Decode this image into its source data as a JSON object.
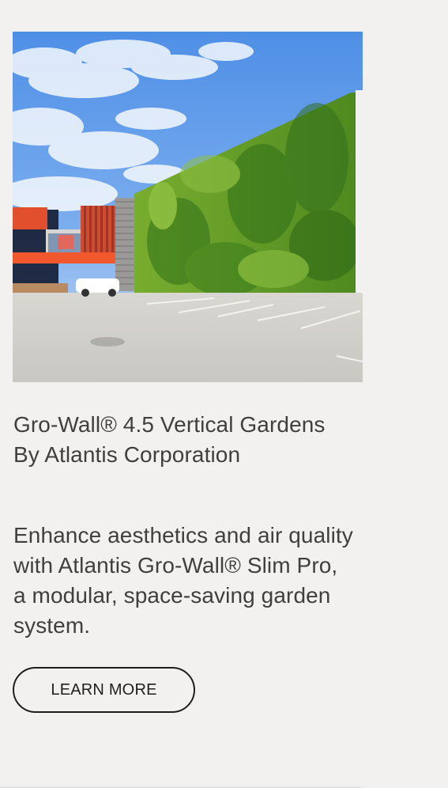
{
  "card": {
    "image_alt": "Gro-Wall vertical garden on a retail building exterior",
    "title_line1": "Gro-Wall® 4.5 Vertical Gardens",
    "title_line2": "By Atlantis Corporation",
    "description": "Enhance aesthetics and air quality with Atlantis Gro-Wall® Slim Pro, a modular, space-saving garden system.",
    "button_label": "LEARN MORE"
  },
  "colors": {
    "page_background": "#f2f1ef",
    "text": "#3f3f3f",
    "button_border": "#1c1c1c"
  }
}
